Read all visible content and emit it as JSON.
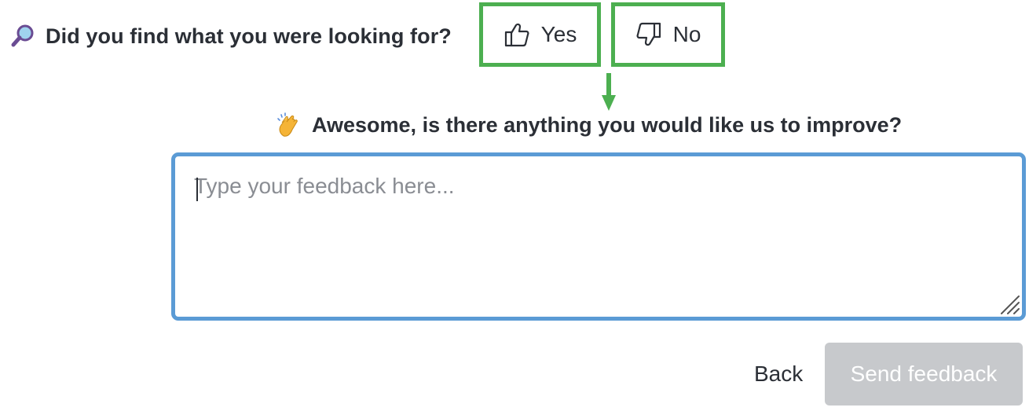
{
  "survey": {
    "question": "Did you find what you were looking for?",
    "yes_label": "Yes",
    "no_label": "No"
  },
  "followup": {
    "question": "Awesome, is there anything you would like us to improve?",
    "input_placeholder": "Type your feedback here...",
    "input_value": ""
  },
  "actions": {
    "back_label": "Back",
    "send_label": "Send feedback",
    "send_disabled": true
  },
  "icons": {
    "question_icon": "magnifier-icon",
    "followup_icon": "clapping-hands-icon",
    "yes_icon": "thumbs-up-icon",
    "no_icon": "thumbs-down-icon"
  },
  "colors": {
    "highlight_border": "#4caf50",
    "input_focus_border": "#5b9bd5",
    "disabled_button_bg": "#c7c9cc",
    "text": "#2b2f36"
  }
}
